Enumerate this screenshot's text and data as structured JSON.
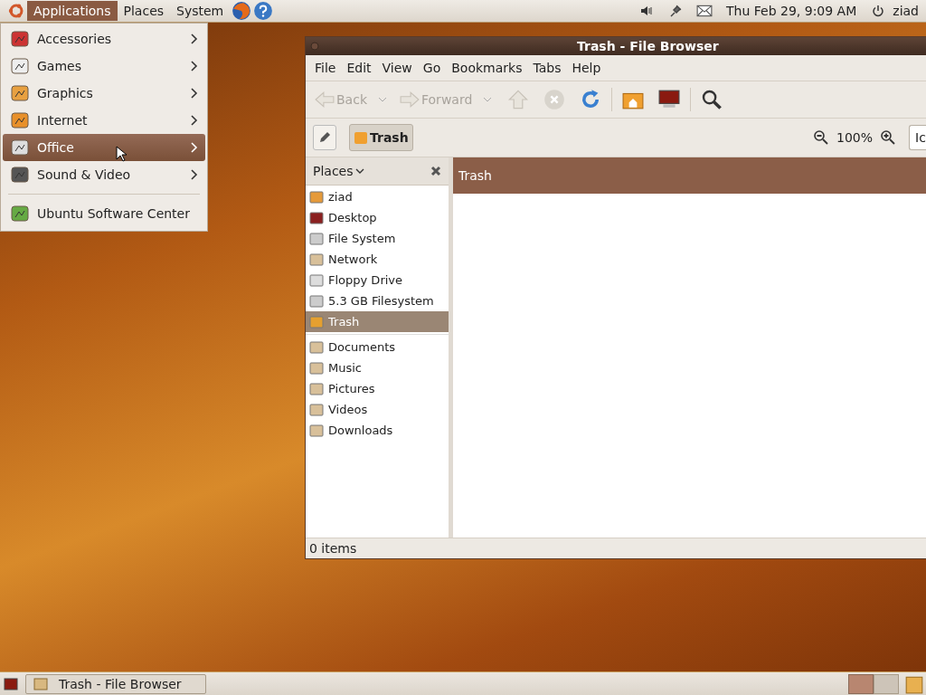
{
  "top_panel": {
    "menus": [
      {
        "label": "Applications",
        "selected": true
      },
      {
        "label": "Places",
        "selected": false
      },
      {
        "label": "System",
        "selected": false
      }
    ],
    "clock": "Thu Feb 29,  9:09 AM",
    "user": "ziad"
  },
  "app_menu": {
    "items": [
      {
        "label": "Accessories",
        "kind": "submenu",
        "selected": false
      },
      {
        "label": "Games",
        "kind": "submenu",
        "selected": false
      },
      {
        "label": "Graphics",
        "kind": "submenu",
        "selected": false
      },
      {
        "label": "Internet",
        "kind": "submenu",
        "selected": false
      },
      {
        "label": "Office",
        "kind": "submenu",
        "selected": true
      },
      {
        "label": "Sound & Video",
        "kind": "submenu",
        "selected": false
      },
      {
        "label": "Ubuntu Software Center",
        "kind": "launcher",
        "selected": false
      }
    ]
  },
  "window": {
    "title": "Trash - File Browser",
    "menubar": [
      "File",
      "Edit",
      "View",
      "Go",
      "Bookmarks",
      "Tabs",
      "Help"
    ],
    "toolbar": [
      {
        "label": "Back",
        "disabled": true
      },
      {
        "label": "Forward",
        "disabled": true
      }
    ],
    "location": {
      "label": "Trash"
    },
    "zoom": "100%",
    "view_combo": "Ic",
    "sidebar": {
      "title": "Places",
      "groups": [
        [
          {
            "label": "ziad",
            "selected": false
          },
          {
            "label": "Desktop",
            "selected": false
          },
          {
            "label": "File System",
            "selected": false
          },
          {
            "label": "Network",
            "selected": false
          },
          {
            "label": "Floppy Drive",
            "selected": false
          },
          {
            "label": "5.3 GB Filesystem",
            "selected": false
          },
          {
            "label": "Trash",
            "selected": true
          }
        ],
        [
          {
            "label": "Documents",
            "selected": false
          },
          {
            "label": "Music",
            "selected": false
          },
          {
            "label": "Pictures",
            "selected": false
          },
          {
            "label": "Videos",
            "selected": false
          },
          {
            "label": "Downloads",
            "selected": false
          }
        ]
      ]
    },
    "content_header": "Trash",
    "status": "0 items"
  },
  "taskbar": {
    "tasks": [
      {
        "label": "Trash - File Browser"
      }
    ]
  }
}
